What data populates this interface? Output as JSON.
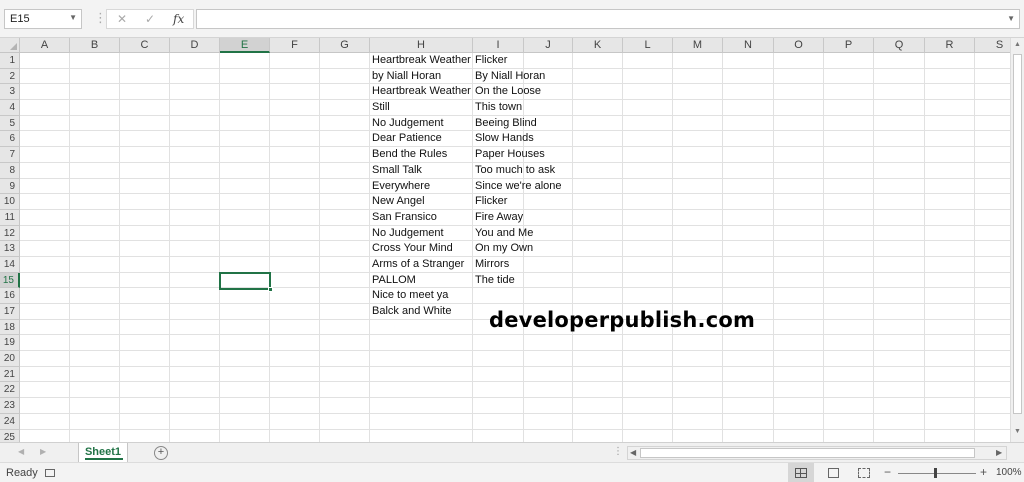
{
  "formula_bar": {
    "name_box": "E15",
    "cancel_glyph": "✕",
    "enter_glyph": "✓",
    "function_glyph": "fx",
    "formula_value": ""
  },
  "grid": {
    "columns": [
      "A",
      "B",
      "C",
      "D",
      "E",
      "F",
      "G",
      "H",
      "I",
      "J",
      "K",
      "L",
      "M",
      "N",
      "O",
      "P",
      "Q",
      "R",
      "S"
    ],
    "rows": [
      "1",
      "2",
      "3",
      "4",
      "5",
      "6",
      "7",
      "8",
      "9",
      "10",
      "11",
      "12",
      "13",
      "14",
      "15",
      "16",
      "17",
      "18",
      "19",
      "20",
      "21",
      "22",
      "23",
      "24",
      "25"
    ],
    "active_cell": "E15",
    "active_column": "E",
    "active_row": "15",
    "column_H": [
      "Heartbreak Weather",
      "by  Niall Horan",
      "Heartbreak Weather",
      "Still",
      "No Judgement",
      "Dear Patience",
      "Bend the Rules",
      "Small Talk",
      "Everywhere",
      "New Angel",
      "San Fransico",
      "No Judgement",
      "Cross Your Mind",
      "Arms of a Stranger",
      "PALLOM",
      "Nice to meet ya",
      "Balck and White"
    ],
    "column_I": [
      "Flicker",
      "By Niall Horan",
      "On the Loose",
      "This town",
      "Beeing Blind",
      "Slow Hands",
      "Paper Houses",
      "Too much to ask",
      "Since we're alone",
      "Flicker",
      "Fire Away",
      "You and Me",
      "On my Own",
      "Mirrors",
      "The tide"
    ]
  },
  "watermark": "developerpublish.com",
  "sheet_tabs": [
    {
      "label": "Sheet1",
      "active": true
    }
  ],
  "add_sheet_glyph": "+",
  "status": {
    "ready": "Ready",
    "zoom_minus": "−",
    "zoom_plus": "+",
    "zoom": "100%",
    "zoom_fraction": 0.47
  }
}
